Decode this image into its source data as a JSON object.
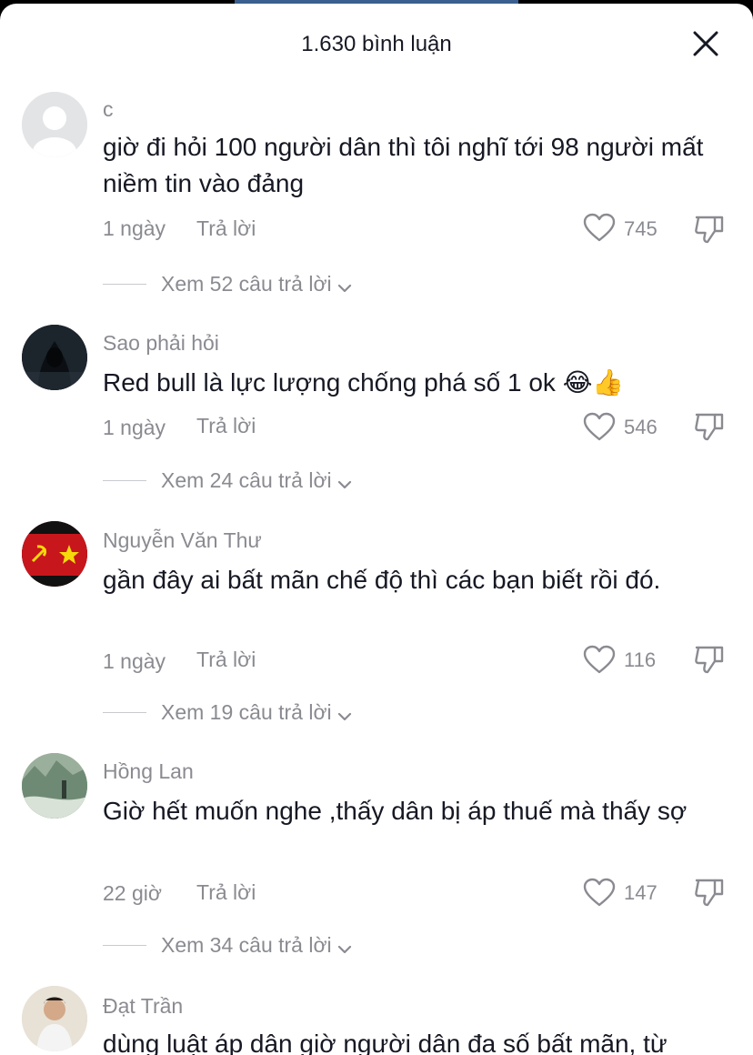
{
  "header": {
    "title": "1.630 bình luận"
  },
  "icons": {
    "close": "close-icon",
    "like": "heart-outline-icon",
    "dislike": "thumbs-down-icon",
    "chevron": "chevron-down-icon"
  },
  "reply_label": "Trả lời",
  "comments": [
    {
      "username": "c",
      "text": "giờ đi hỏi 100 người dân thì tôi nghĩ tới 98 người mất niềm tin vào đảng",
      "time": "1 ngày",
      "likes": "745",
      "replies": "Xem 52 câu trả lời"
    },
    {
      "username": "Sao phải hỏi",
      "text": "Red bull là lực lượng chống phá số 1 ok 😂👍",
      "time": "1 ngày",
      "likes": "546",
      "replies": "Xem 24 câu trả lời"
    },
    {
      "username": "Nguyễn Văn Thư",
      "text": "gần đây ai bất mãn chế độ thì các bạn biết rồi đó.",
      "time": "1 ngày",
      "likes": "116",
      "replies": "Xem 19 câu trả lời"
    },
    {
      "username": "Hồng Lan",
      "text": "Giờ hết muốn nghe ,thấy dân bị áp thuế mà thấy sợ",
      "time": "22 giờ",
      "likes": "147",
      "replies": "Xem 34 câu trả lời"
    },
    {
      "username": "Đạt Trần",
      "text": "dùng luật áp dân giờ người dân đa số bất mãn, từ"
    }
  ]
}
